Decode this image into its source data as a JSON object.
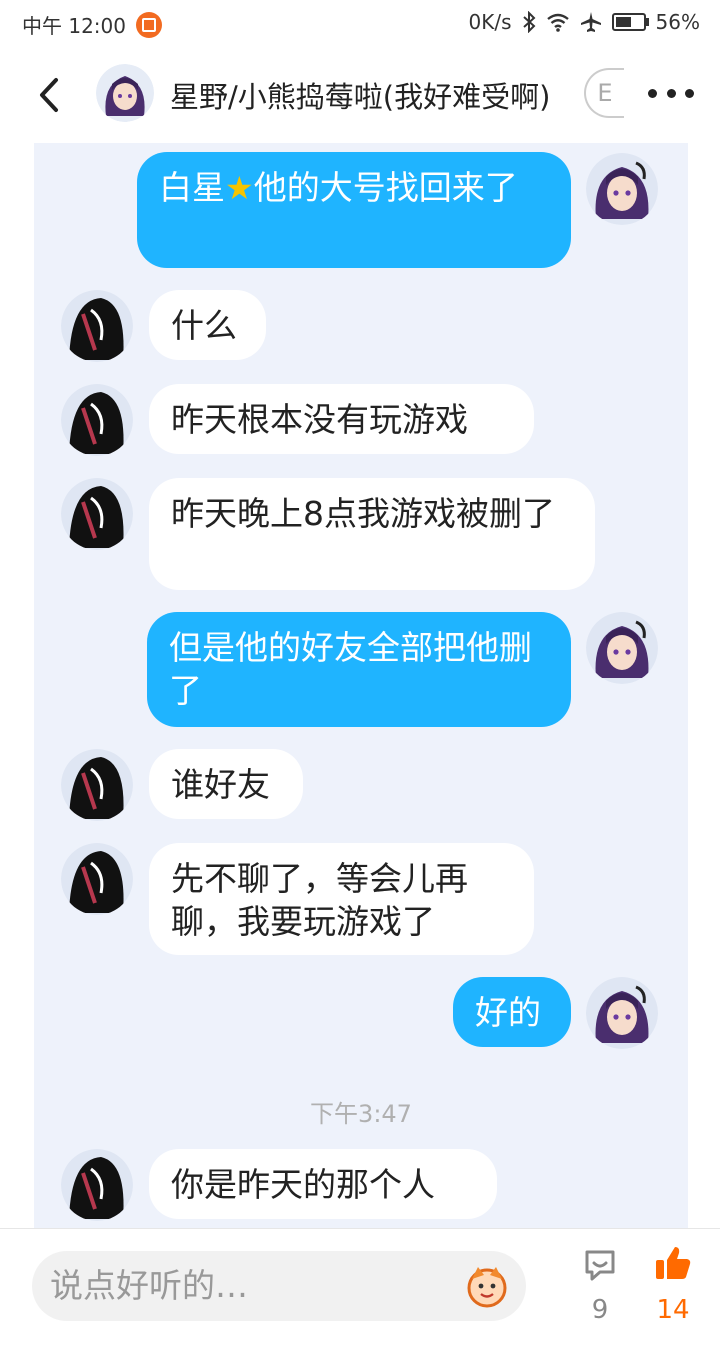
{
  "status_bar": {
    "left_text": "中午 12:00",
    "net_speed": "0K/s",
    "battery_percent": "56%",
    "battery_level": 0.56
  },
  "header": {
    "title": "星野/小熊捣莓啦(我好难受啊)",
    "pill_glyph": "E"
  },
  "messages": [
    {
      "side": "out",
      "lines": [
        "白星",
        "他的大号找回来了"
      ]
    },
    {
      "side": "in",
      "text": "什么"
    },
    {
      "side": "in",
      "text": "昨天根本没有玩游戏"
    },
    {
      "side": "in",
      "text": "昨天晚上8点我游戏被删了"
    },
    {
      "side": "out",
      "text": "但是他的好友全部把他删了"
    },
    {
      "side": "in",
      "text": "谁好友"
    },
    {
      "side": "in",
      "text": "先不聊了，等会儿再聊，我要玩游戏了"
    },
    {
      "side": "out",
      "text": "好的"
    },
    {
      "side": "in",
      "text": "你是昨天的那个人"
    }
  ],
  "timestamp": "下午3:47",
  "input": {
    "placeholder": "说点好听的…"
  },
  "actions": {
    "comment_count": "9",
    "like_count": "14"
  },
  "colors": {
    "accent": "#1fb4ff",
    "like": "#ff6a00",
    "notif": "#f26b21"
  },
  "icons": [
    "back-arrow-icon",
    "more-icon",
    "mascot-icon",
    "comment-icon",
    "thumbs-up-icon",
    "star-icon"
  ]
}
